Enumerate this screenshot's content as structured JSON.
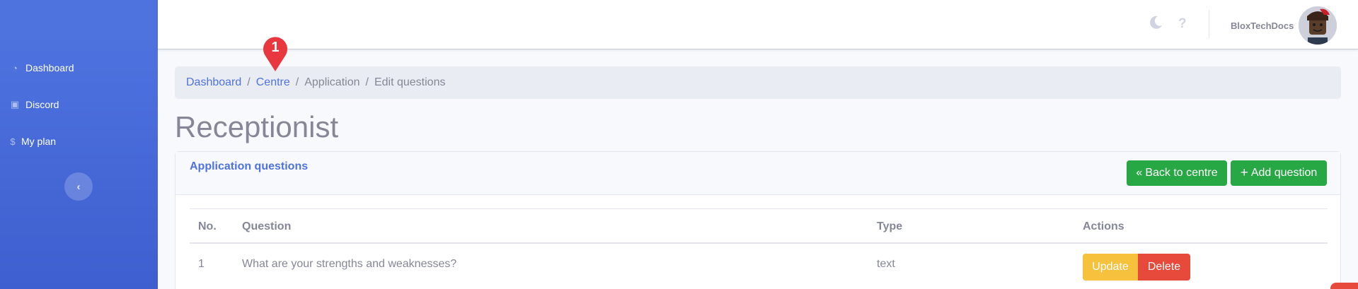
{
  "sidebar": {
    "items": [
      {
        "label": "Dashboard",
        "icon": "dashboard-icon"
      },
      {
        "label": "Discord",
        "icon": "discord-icon"
      },
      {
        "label": "My plan",
        "icon": "dollar-icon"
      }
    ],
    "toggle_icon": "chevron-left-icon"
  },
  "topbar": {
    "username": "BloxTechDocs",
    "icons": [
      "moon-icon",
      "question-icon"
    ]
  },
  "breadcrumb": {
    "items": [
      "Dashboard",
      "Centre",
      "Application",
      "Edit questions"
    ],
    "separator": "/"
  },
  "marker": {
    "label": "1"
  },
  "page": {
    "title": "Receptionist"
  },
  "card": {
    "title": "Application questions",
    "back_label": "Back to centre",
    "add_label": "Add question"
  },
  "table": {
    "headers": [
      "No.",
      "Question",
      "Type",
      "Actions"
    ],
    "rows": [
      {
        "no": "1",
        "question": "What are your strengths and weaknesses?",
        "type": "text",
        "update_label": "Update",
        "delete_label": "Delete"
      }
    ]
  },
  "colors": {
    "primary": "#4e73df",
    "success": "#28a745",
    "warning": "#f6c23e",
    "danger": "#e74a3b",
    "marker": "#e8373f"
  }
}
